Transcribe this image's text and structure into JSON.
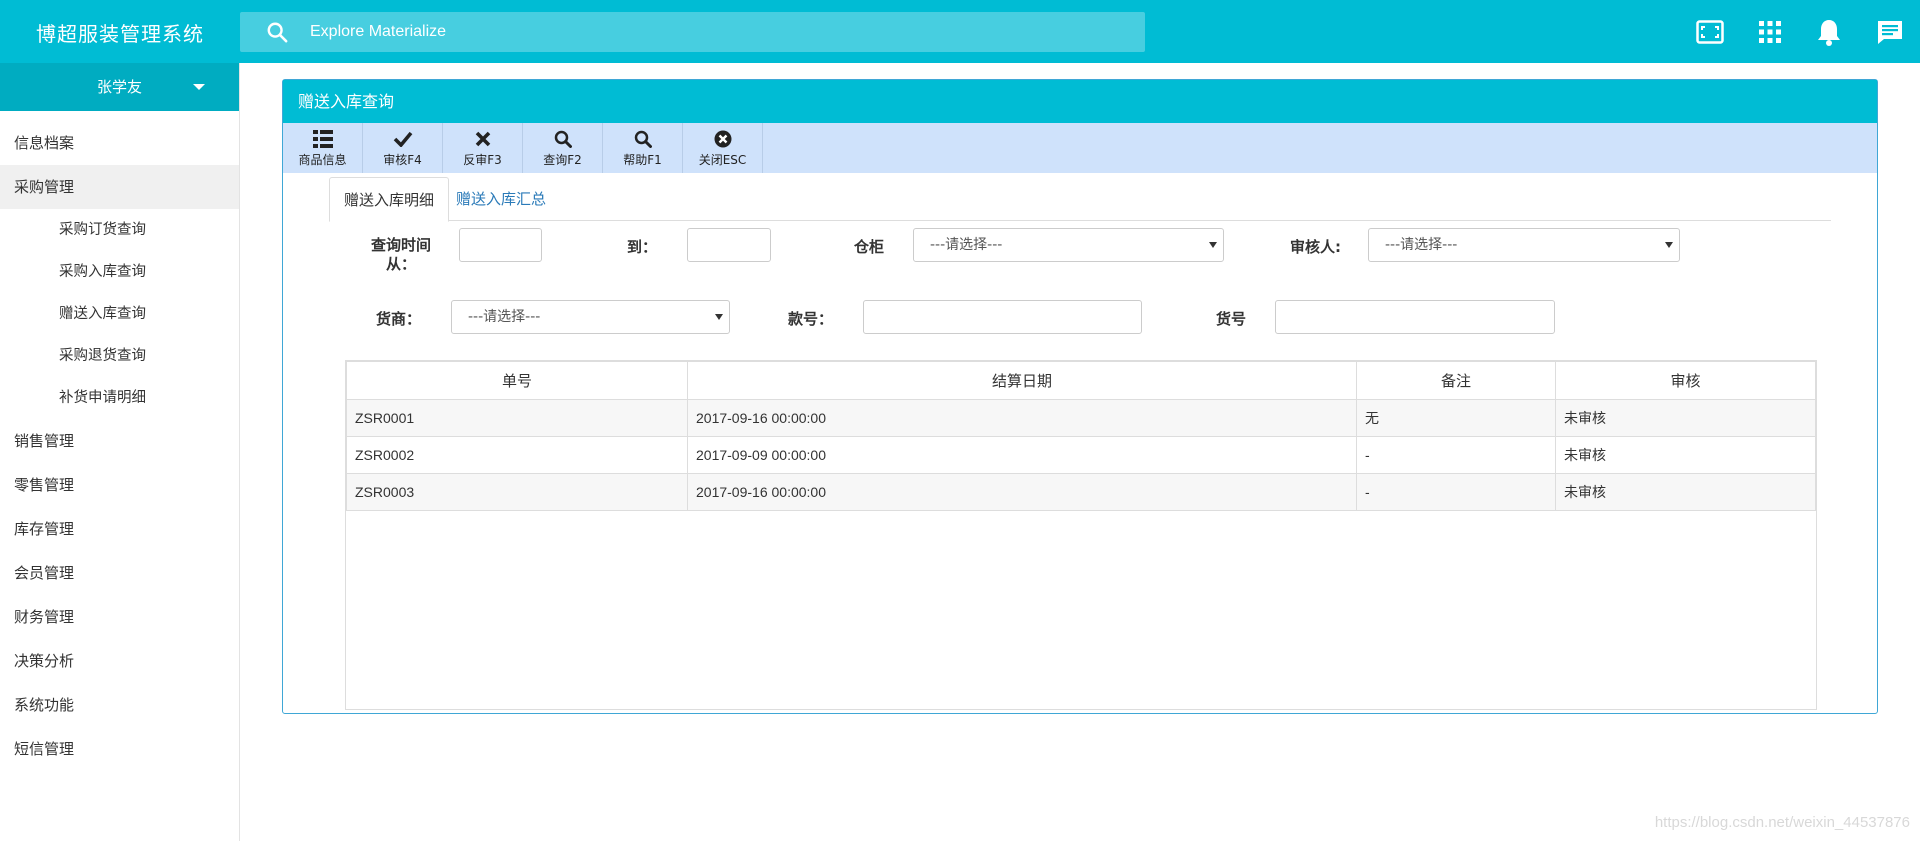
{
  "app": {
    "title": "博超服装管理系统"
  },
  "search": {
    "placeholder": "Explore Materialize"
  },
  "topbar_icons": [
    "fullscreen-icon",
    "apps-grid-icon",
    "notifications-icon",
    "chat-icon"
  ],
  "sidebar": {
    "user": "张学友",
    "items": [
      {
        "label": "信息档案"
      },
      {
        "label": "采购管理"
      },
      {
        "label": "采购订货查询"
      },
      {
        "label": "采购入库查询"
      },
      {
        "label": "赠送入库查询"
      },
      {
        "label": "采购退货查询"
      },
      {
        "label": "补货申请明细"
      },
      {
        "label": "销售管理"
      },
      {
        "label": "零售管理"
      },
      {
        "label": "库存管理"
      },
      {
        "label": "会员管理"
      },
      {
        "label": "财务管理"
      },
      {
        "label": "决策分析"
      },
      {
        "label": "系统功能"
      },
      {
        "label": "短信管理"
      }
    ]
  },
  "panel": {
    "title": "赠送入库查询"
  },
  "toolbar": {
    "buttons": [
      {
        "label": "商品信息",
        "icon": "list-icon"
      },
      {
        "label": "审核F4",
        "icon": "check-icon"
      },
      {
        "label": "反审F3",
        "icon": "close-icon"
      },
      {
        "label": "查询F2",
        "icon": "search-icon"
      },
      {
        "label": "帮助F1",
        "icon": "search-icon"
      },
      {
        "label": "关闭ESC",
        "icon": "close-circle-icon"
      }
    ]
  },
  "tabs": [
    {
      "label": "赠送入库明细"
    },
    {
      "label": "赠送入库汇总"
    }
  ],
  "filters": {
    "date_from_label": "查询时间从：",
    "date_from_line1": "查询时间",
    "date_from_line2": "从：",
    "date_to_label": "到：",
    "warehouse_label": "仓柜",
    "warehouse_value": "---请选择---",
    "auditor_label": "审核人:",
    "auditor_value": "---请选择---",
    "supplier_label": "货商：",
    "supplier_value": "---请选择---",
    "style_no_label": "款号：",
    "item_no_label": "货号"
  },
  "table": {
    "headers": [
      "单号",
      "结算日期",
      "备注",
      "审核"
    ],
    "rows": [
      [
        "ZSR0001",
        "2017-09-16 00:00:00",
        "无",
        "未审核"
      ],
      [
        "ZSR0002",
        "2017-09-09 00:00:00",
        "-",
        "未审核"
      ],
      [
        "ZSR0003",
        "2017-09-16 00:00:00",
        "-",
        "未审核"
      ]
    ]
  },
  "watermark": "https://blog.csdn.net/weixin_44537876"
}
